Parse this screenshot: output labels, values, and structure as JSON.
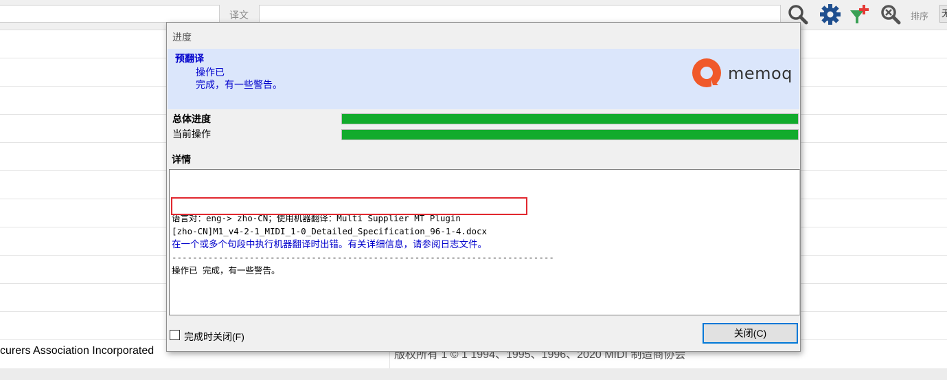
{
  "toolbar": {
    "target_label": "译文",
    "sort_label": "排序",
    "sort_value": "无"
  },
  "grid": {
    "source_text": "curers Association Incorporated",
    "target_text": "版权所有 1 © 1 1994、1995、1996、2020 MIDI 制造商协会"
  },
  "dialog": {
    "title": "进度",
    "task_title": "预翻译",
    "task_status": "操作已",
    "task_result": "完成，有一些警告。",
    "logo_text": "memoq",
    "overall_progress_label": "总体进度",
    "overall_progress": 100,
    "current_operation_label": "当前操作",
    "current_progress": 100,
    "details_label": "详情",
    "log": [
      {
        "text": "语言对：eng-> zho-CN；使用机器翻译：Multi Supplier MT Plugin",
        "type": "normal"
      },
      {
        "text": "[zho-CN]M1_v4-2-1_MIDI_1-0_Detailed_Specification_96-1-4.docx",
        "type": "normal"
      },
      {
        "text": "在一个或多个句段中执行机器翻译时出错。有关详细信息，请参阅日志文件。",
        "type": "warn"
      },
      {
        "text": "--------------------------------------------------------------------------",
        "type": "normal"
      },
      {
        "text": "操作已 完成，有一些警告。",
        "type": "normal"
      }
    ],
    "close_on_complete_label": "完成时关闭(F)",
    "close_on_complete_checked": false,
    "close_button_label": "关闭(C)"
  },
  "colors": {
    "accent_blue": "#0000cc",
    "progress_green": "#12ab2c",
    "highlight_red": "#e1272e",
    "header_bg": "#dbe6fb",
    "logo_orange": "#f0592a"
  }
}
